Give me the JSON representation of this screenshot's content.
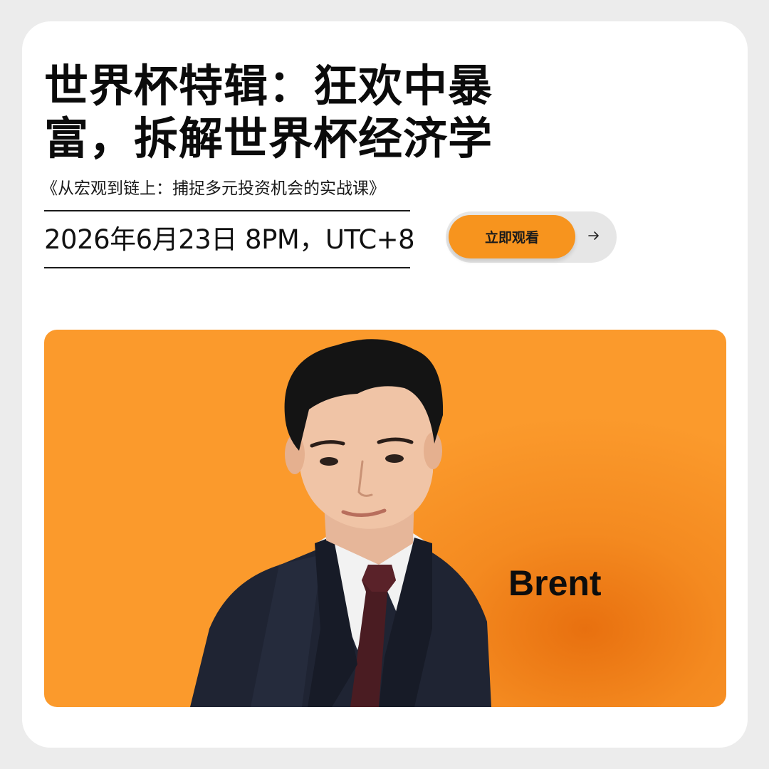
{
  "event": {
    "title_line1": "世界杯特辑：狂欢中暴",
    "title_line2": "富，拆解世界杯经济学",
    "subtitle": "《从宏观到链上：捕捉多元投资机会的实战课》",
    "datetime": "2026年6月23日 8PM，UTC+8"
  },
  "cta": {
    "label": "立即观看",
    "icon": "arrow-right-icon"
  },
  "speaker": {
    "name": "Brent"
  },
  "colors": {
    "accent": "#f7941e",
    "panel": "#fb9a2c",
    "text": "#0b0b0b",
    "background": "#ececec",
    "card": "#ffffff"
  }
}
